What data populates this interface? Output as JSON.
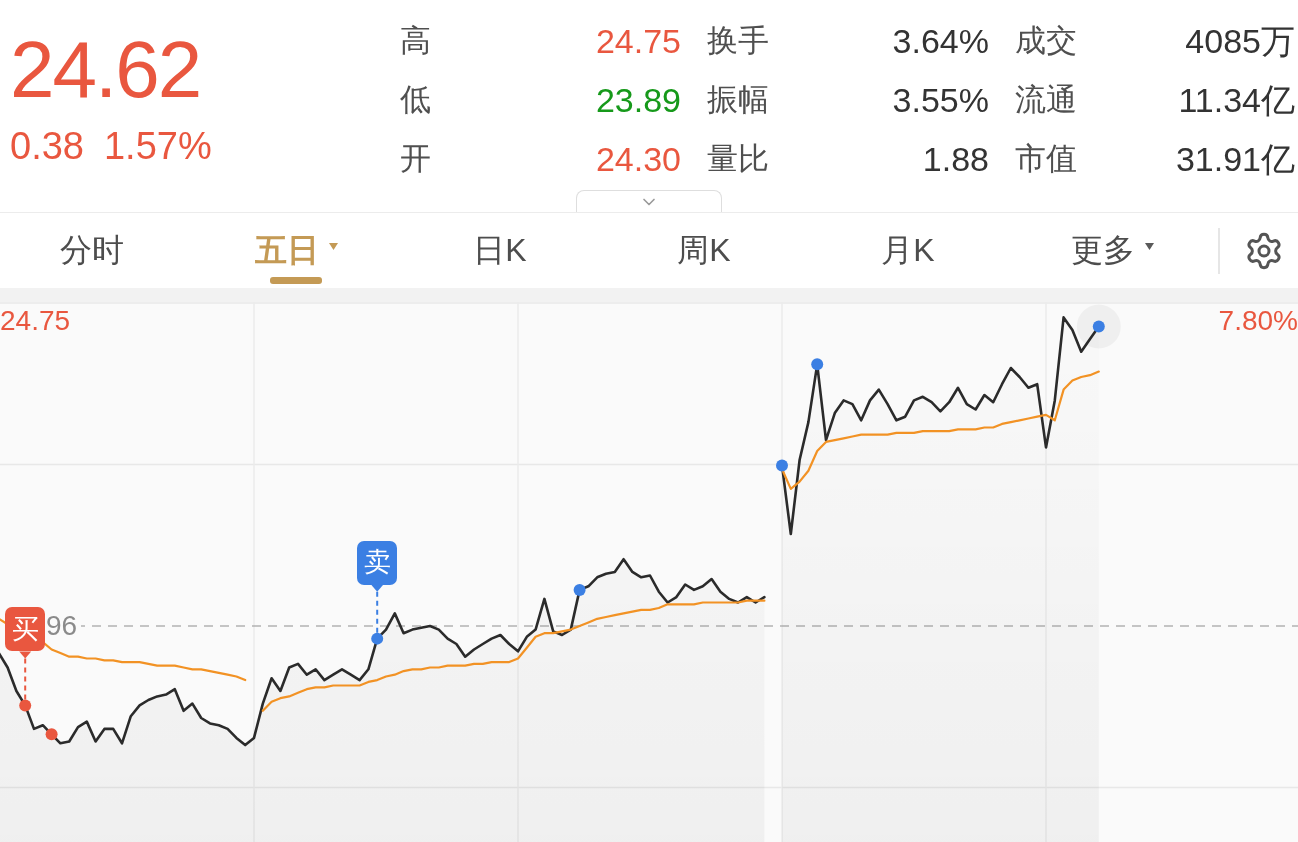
{
  "quote": {
    "price": "24.62",
    "change": "0.38",
    "change_percent": "1.57%",
    "color": "#e9573f"
  },
  "stats": [
    {
      "label": "高",
      "value": "24.75",
      "color": "#e9573f"
    },
    {
      "label": "换手",
      "value": "3.64%",
      "color": "#333333"
    },
    {
      "label": "成交",
      "value": "4085万",
      "color": "#333333"
    },
    {
      "label": "低",
      "value": "23.89",
      "color": "#16991a"
    },
    {
      "label": "振幅",
      "value": "3.55%",
      "color": "#333333"
    },
    {
      "label": "流通",
      "value": "11.34亿",
      "color": "#333333"
    },
    {
      "label": "开",
      "value": "24.30",
      "color": "#e9573f"
    },
    {
      "label": "量比",
      "value": "1.88",
      "color": "#333333"
    },
    {
      "label": "市值",
      "value": "31.91亿",
      "color": "#333333"
    }
  ],
  "expand_toggle": {
    "expanded": false
  },
  "tabs": [
    {
      "label": "分时",
      "selected": false,
      "dropdown": false
    },
    {
      "label": "五日",
      "selected": true,
      "dropdown": true
    },
    {
      "label": "日K",
      "selected": false,
      "dropdown": false
    },
    {
      "label": "周K",
      "selected": false,
      "dropdown": false
    },
    {
      "label": "月K",
      "selected": false,
      "dropdown": false
    },
    {
      "label": "更多",
      "selected": false,
      "dropdown": true
    }
  ],
  "chart": {
    "top_price": "24.75",
    "top_percent": "7.80%",
    "base_price": "96",
    "tags": [
      {
        "kind": "buy",
        "label": "买"
      },
      {
        "kind": "sell",
        "label": "卖"
      }
    ]
  }
}
